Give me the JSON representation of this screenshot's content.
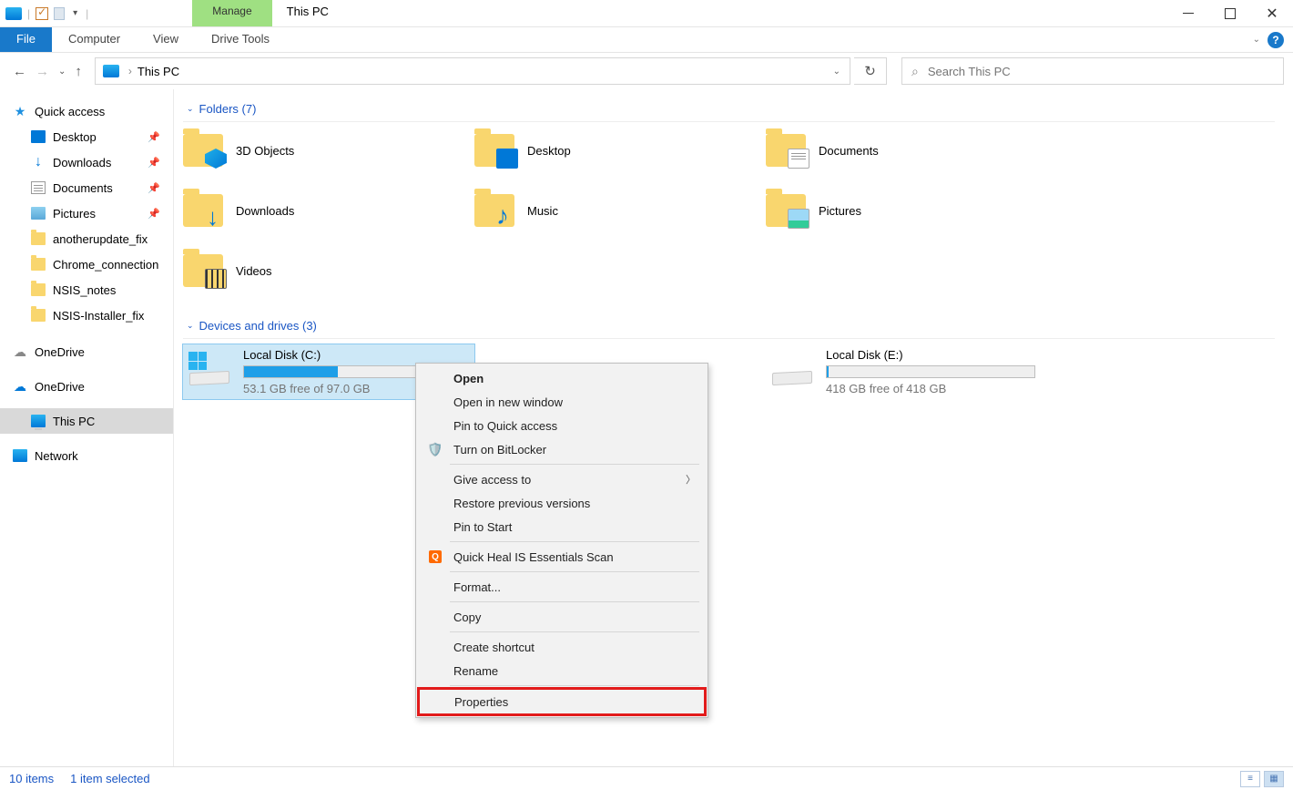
{
  "window": {
    "title": "This PC",
    "context_tab": "Manage"
  },
  "ribbon": {
    "file": "File",
    "tabs": [
      "Computer",
      "View"
    ],
    "context_tab": "Drive Tools"
  },
  "address": {
    "location": "This PC"
  },
  "search": {
    "placeholder": "Search This PC"
  },
  "sidebar": {
    "quick_access": "Quick access",
    "items": [
      {
        "label": "Desktop",
        "pinned": true
      },
      {
        "label": "Downloads",
        "pinned": true
      },
      {
        "label": "Documents",
        "pinned": true
      },
      {
        "label": "Pictures",
        "pinned": true
      },
      {
        "label": "anotherupdate_fix",
        "pinned": false
      },
      {
        "label": "Chrome_connection",
        "pinned": false
      },
      {
        "label": "NSIS_notes",
        "pinned": false
      },
      {
        "label": "NSIS-Installer_fix",
        "pinned": false
      }
    ],
    "onedrive1": "OneDrive",
    "onedrive2": "OneDrive",
    "this_pc": "This PC",
    "network": "Network"
  },
  "sections": {
    "folders": {
      "title": "Folders (7)",
      "items": [
        "3D Objects",
        "Desktop",
        "Documents",
        "Downloads",
        "Music",
        "Pictures",
        "Videos"
      ]
    },
    "drives": {
      "title": "Devices and drives (3)",
      "items": [
        {
          "name": "Local Disk (C:)",
          "free_text": "53.1 GB free of 97.0 GB",
          "fill_pct": 45,
          "selected": true,
          "has_win": true
        },
        {
          "name": "Local Disk (E:)",
          "free_text": "418 GB free of 418 GB",
          "fill_pct": 1,
          "selected": false,
          "has_win": false
        }
      ]
    }
  },
  "context_menu": {
    "items": [
      {
        "label": "Open",
        "bold": true
      },
      {
        "label": "Open in new window"
      },
      {
        "label": "Pin to Quick access"
      },
      {
        "label": "Turn on BitLocker",
        "icon": "shield"
      },
      {
        "sep": true
      },
      {
        "label": "Give access to",
        "submenu": true
      },
      {
        "label": "Restore previous versions"
      },
      {
        "label": "Pin to Start"
      },
      {
        "sep": true
      },
      {
        "label": "Quick Heal IS Essentials Scan",
        "icon": "qh"
      },
      {
        "sep": true
      },
      {
        "label": "Format..."
      },
      {
        "sep": true
      },
      {
        "label": "Copy"
      },
      {
        "sep": true
      },
      {
        "label": "Create shortcut"
      },
      {
        "label": "Rename"
      },
      {
        "sep": true
      },
      {
        "label": "Properties",
        "highlight": true
      }
    ]
  },
  "status": {
    "count": "10 items",
    "selected": "1 item selected"
  }
}
